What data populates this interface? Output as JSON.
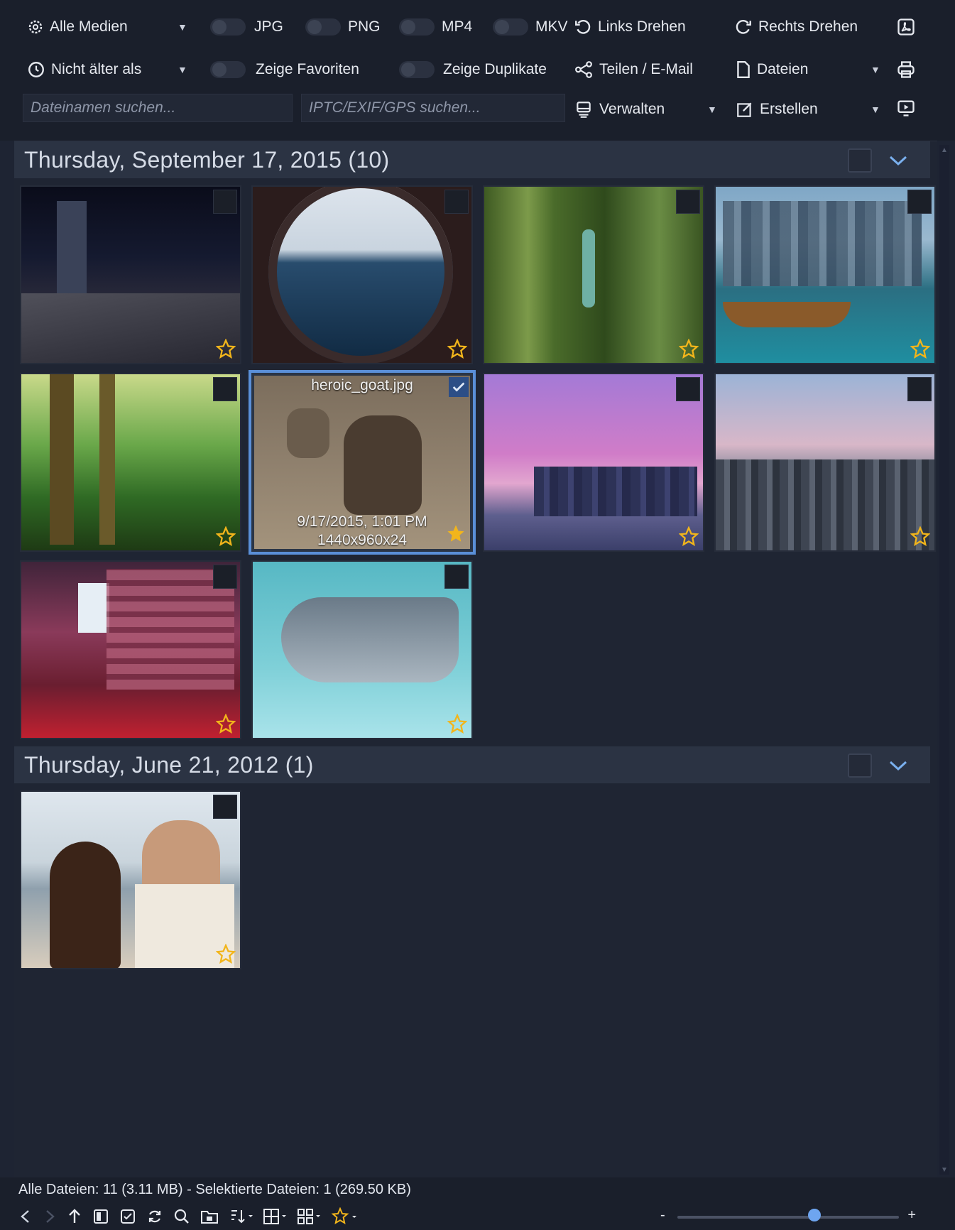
{
  "toolbar": {
    "media_filter": "Alle Medien",
    "age_filter": "Nicht älter als",
    "toggles": {
      "jpg": "JPG",
      "png": "PNG",
      "mp4": "MP4",
      "mkv": "MKV",
      "favorites": "Zeige Favoriten",
      "duplicates": "Zeige Duplikate"
    },
    "rotate_left": "Links Drehen",
    "rotate_right": "Rechts Drehen",
    "share": "Teilen / E-Mail",
    "files": "Dateien",
    "manage": "Verwalten",
    "create": "Erstellen",
    "filename_search_placeholder": "Dateinamen suchen...",
    "meta_search_placeholder": "IPTC/EXIF/GPS suchen..."
  },
  "groups": [
    {
      "title": "Thursday, September 17, 2015  (10)"
    },
    {
      "title": "Thursday, June 21, 2012  (1)"
    }
  ],
  "selected_thumb": {
    "filename": "heroic_goat.jpg",
    "date": "9/17/2015, 1:01 PM",
    "size": "1440x960x24"
  },
  "status": {
    "text": "Alle Dateien: 11 (3.11 MB) - Selektierte Dateien: 1 (269.50 KB)"
  },
  "thumbnail_size_fraction": 0.62,
  "colors": {
    "accent": "#5a8fd8",
    "star": "#f2b51b"
  }
}
